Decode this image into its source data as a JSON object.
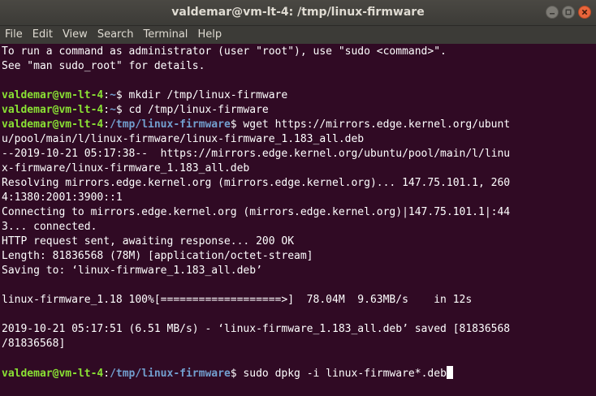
{
  "window": {
    "title": "valdemar@vm-lt-4: /tmp/linux-firmware"
  },
  "menu": {
    "items": [
      "File",
      "Edit",
      "View",
      "Search",
      "Terminal",
      "Help"
    ]
  },
  "terminal": {
    "sudo_notice_1": "To run a command as administrator (user \"root\"), use \"sudo <command>\".",
    "sudo_notice_2": "See \"man sudo_root\" for details.",
    "prompt_user_host": "valdemar@vm-lt-4",
    "home_path": "~",
    "work_path": "/tmp/linux-firmware",
    "cmd1": " mkdir /tmp/linux-firmware",
    "cmd2": " cd /tmp/linux-firmware",
    "cmd3_start": " wget https://mirrors.edge.kernel.org/ubunt",
    "cmd3_cont": "u/pool/main/l/linux-firmware/linux-firmware_1.183_all.deb",
    "out1": "--2019-10-21 05:17:38--  https://mirrors.edge.kernel.org/ubuntu/pool/main/l/linu",
    "out2": "x-firmware/linux-firmware_1.183_all.deb",
    "out3": "Resolving mirrors.edge.kernel.org (mirrors.edge.kernel.org)... 147.75.101.1, 260",
    "out4": "4:1380:2001:3900::1",
    "out5": "Connecting to mirrors.edge.kernel.org (mirrors.edge.kernel.org)|147.75.101.1|:44",
    "out6": "3... connected.",
    "out7": "HTTP request sent, awaiting response... 200 OK",
    "out8": "Length: 81836568 (78M) [application/octet-stream]",
    "out9": "Saving to: ‘linux-firmware_1.183_all.deb’",
    "progress": "linux-firmware_1.18 100%[===================>]  78.04M  9.63MB/s    in 12s",
    "saved1": "2019-10-21 05:17:51 (6.51 MB/s) - ‘linux-firmware_1.183_all.deb’ saved [81836568",
    "saved2": "/81836568]",
    "cmd4": " sudo dpkg -i linux-firmware*.deb"
  },
  "colors": {
    "background": "#300a24",
    "prompt_user": "#8ae234",
    "prompt_path": "#729fcf",
    "close_button": "#e9653b"
  },
  "icons": {
    "minimize": "minimize-icon",
    "maximize": "maximize-icon",
    "close": "close-icon"
  }
}
